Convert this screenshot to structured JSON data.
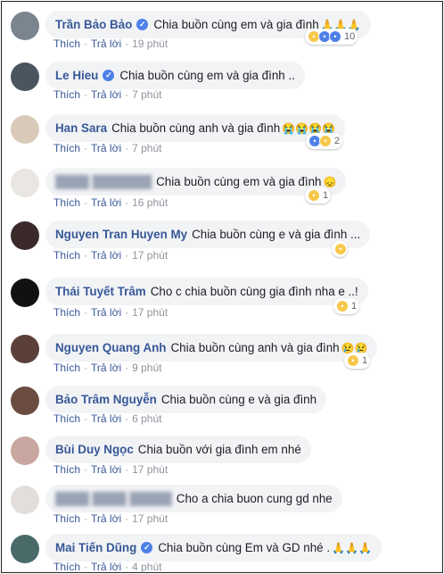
{
  "actions": {
    "like": "Thích",
    "reply": "Trả lời"
  },
  "comments": [
    {
      "author": "Trần Bảo Bảo",
      "verified": true,
      "text": "Chia buồn cùng em và gia đình",
      "emoji": "🙏🙏🙏",
      "time": "19 phút",
      "reaction_count": "10",
      "reactions": [
        "sad-icon",
        "haha-icon",
        "like-icon"
      ],
      "avatar_color": "#7a8590"
    },
    {
      "author": "Le Hieu",
      "verified": true,
      "text": "Chia buồn cùng em và gia đình ..",
      "emoji": "",
      "time": "7 phút",
      "reaction_count": "",
      "reactions": [],
      "avatar_color": "#4a5560"
    },
    {
      "author": "Han Sara",
      "verified": false,
      "text": "Chia buồn cùng anh và gia đình",
      "emoji": "😭😭😭😭",
      "time": "7 phút",
      "reaction_count": "2",
      "reactions": [
        "like-icon",
        "sad-icon"
      ],
      "avatar_color": "#d8c9b8"
    },
    {
      "author": "████ ███████",
      "verified": false,
      "text": "Chia buồn cùng em và gia đình",
      "emoji": "😞",
      "time": "16 phút",
      "reaction_count": "1",
      "reactions": [
        "sad-icon"
      ],
      "avatar_color": "#e9e6e3",
      "blurred": true
    },
    {
      "author": "Nguyen Tran Huyen My",
      "verified": false,
      "text": "Chia buồn cùng e và gia đình ...",
      "emoji": "",
      "time": "17 phút",
      "reaction_count": "",
      "reactions": [
        "sad-icon"
      ],
      "avatar_color": "#3a2a2a"
    },
    {
      "author": "Thái Tuyết Trâm",
      "verified": false,
      "text": "Cho c chia buồn cùng gia đình nha e ..!",
      "emoji": "",
      "time": "17 phút",
      "reaction_count": "1",
      "reactions": [
        "sad-icon"
      ],
      "avatar_color": "#111111"
    },
    {
      "author": "Nguyen Quang Anh",
      "verified": false,
      "text": "Chia buồn cùng anh và gia đình",
      "emoji": "😢😢",
      "time": "9 phút",
      "reaction_count": "1",
      "reactions": [
        "sad-icon"
      ],
      "avatar_color": "#5a4038"
    },
    {
      "author": "Bảo Trâm Nguyễn",
      "verified": false,
      "text": "Chia buồn cùng e và gia đình",
      "emoji": "",
      "time": "6 phút",
      "reaction_count": "",
      "reactions": [],
      "avatar_color": "#6b4c40"
    },
    {
      "author": "Bùi Duy Ngọc",
      "verified": false,
      "text": "Chia buồn với gia đình em nhé",
      "emoji": "",
      "time": "17 phút",
      "reaction_count": "",
      "reactions": [],
      "avatar_color": "#c9a7a0"
    },
    {
      "author": "████ ████ █████",
      "verified": false,
      "text": "Cho a chia buon cung gd nhe",
      "emoji": "",
      "time": "17 phút",
      "reaction_count": "",
      "reactions": [],
      "avatar_color": "#e3dedb",
      "blurred": true
    },
    {
      "author": "Mai Tiến Dũng",
      "verified": true,
      "text": "Chia buồn cùng Em và GD nhé .",
      "emoji": "🙏🙏🙏",
      "time": "4 phút",
      "reaction_count": "",
      "reactions": [],
      "avatar_color": "#4a6a6a"
    }
  ]
}
